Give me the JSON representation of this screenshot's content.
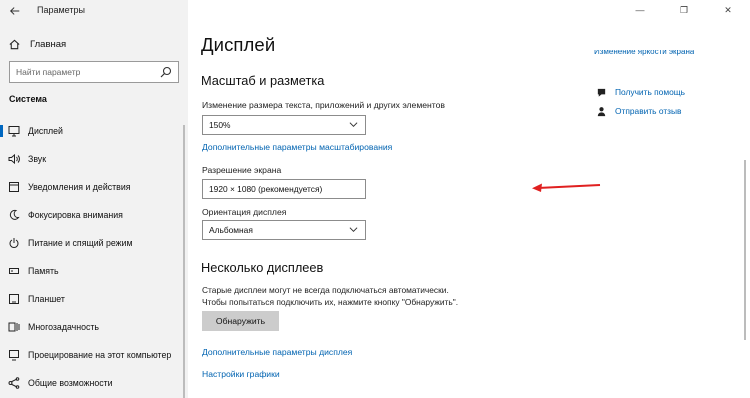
{
  "window": {
    "title": "Параметры",
    "minimize": "—",
    "maximize": "❐",
    "close": "✕"
  },
  "sidebar": {
    "home_label": "Главная",
    "search_placeholder": "Найти параметр",
    "section": "Система",
    "items": [
      {
        "label": "Дисплей",
        "icon": "monitor-icon",
        "active": true
      },
      {
        "label": "Звук",
        "icon": "speaker-icon"
      },
      {
        "label": "Уведомления и действия",
        "icon": "notification-icon"
      },
      {
        "label": "Фокусировка внимания",
        "icon": "moon-icon"
      },
      {
        "label": "Питание и спящий режим",
        "icon": "power-icon"
      },
      {
        "label": "Память",
        "icon": "storage-icon"
      },
      {
        "label": "Планшет",
        "icon": "tablet-icon"
      },
      {
        "label": "Многозадачность",
        "icon": "multitask-icon"
      },
      {
        "label": "Проецирование на этот компьютер",
        "icon": "project-icon"
      },
      {
        "label": "Общие возможности",
        "icon": "share-icon"
      }
    ]
  },
  "main": {
    "title": "Дисплей",
    "scale_heading": "Масштаб и разметка",
    "text_size_label": "Изменение размера текста, приложений и других элементов",
    "text_size_value": "150%",
    "advanced_scaling_link": "Дополнительные параметры масштабирования",
    "resolution_label": "Разрешение экрана",
    "resolution_value": "1920 × 1080 (рекомендуется)",
    "orientation_label": "Ориентация дисплея",
    "orientation_value": "Альбомная",
    "multi_heading": "Несколько дисплеев",
    "multi_text_1": "Старые дисплеи могут не всегда подключаться автоматически.",
    "multi_text_2": "Чтобы попытаться подключить их, нажмите кнопку \"Обнаружить\".",
    "detect_button": "Обнаружить",
    "advanced_display_link": "Дополнительные параметры дисплея",
    "graphics_link": "Настройки графики"
  },
  "right": {
    "top_link": "Изменение яркости экрана",
    "help_link": "Получить помощь",
    "feedback_link": "Отправить отзыв"
  },
  "colors": {
    "accent": "#0067c0",
    "link": "#0063b1",
    "annotation_arrow": "#e02020"
  }
}
